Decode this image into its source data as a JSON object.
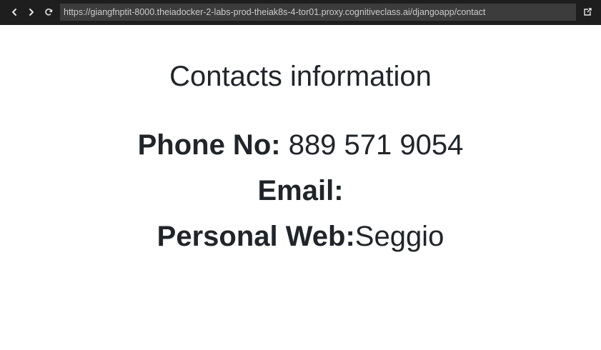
{
  "browser": {
    "url": "https://giangfnptit-8000.theiadocker-2-labs-prod-theiak8s-4-tor01.proxy.cognitiveclass.ai/djangoapp/contact",
    "icons": [
      "chevron-left-icon",
      "chevron-right-icon",
      "reload-icon",
      "external-link-icon"
    ]
  },
  "page": {
    "title": "Contacts information",
    "phone": {
      "label": "Phone No:",
      "value": " 889 571 9054"
    },
    "email": {
      "label": "Email:",
      "value": ""
    },
    "web": {
      "label": "Personal Web:",
      "value": "Seggio"
    }
  }
}
